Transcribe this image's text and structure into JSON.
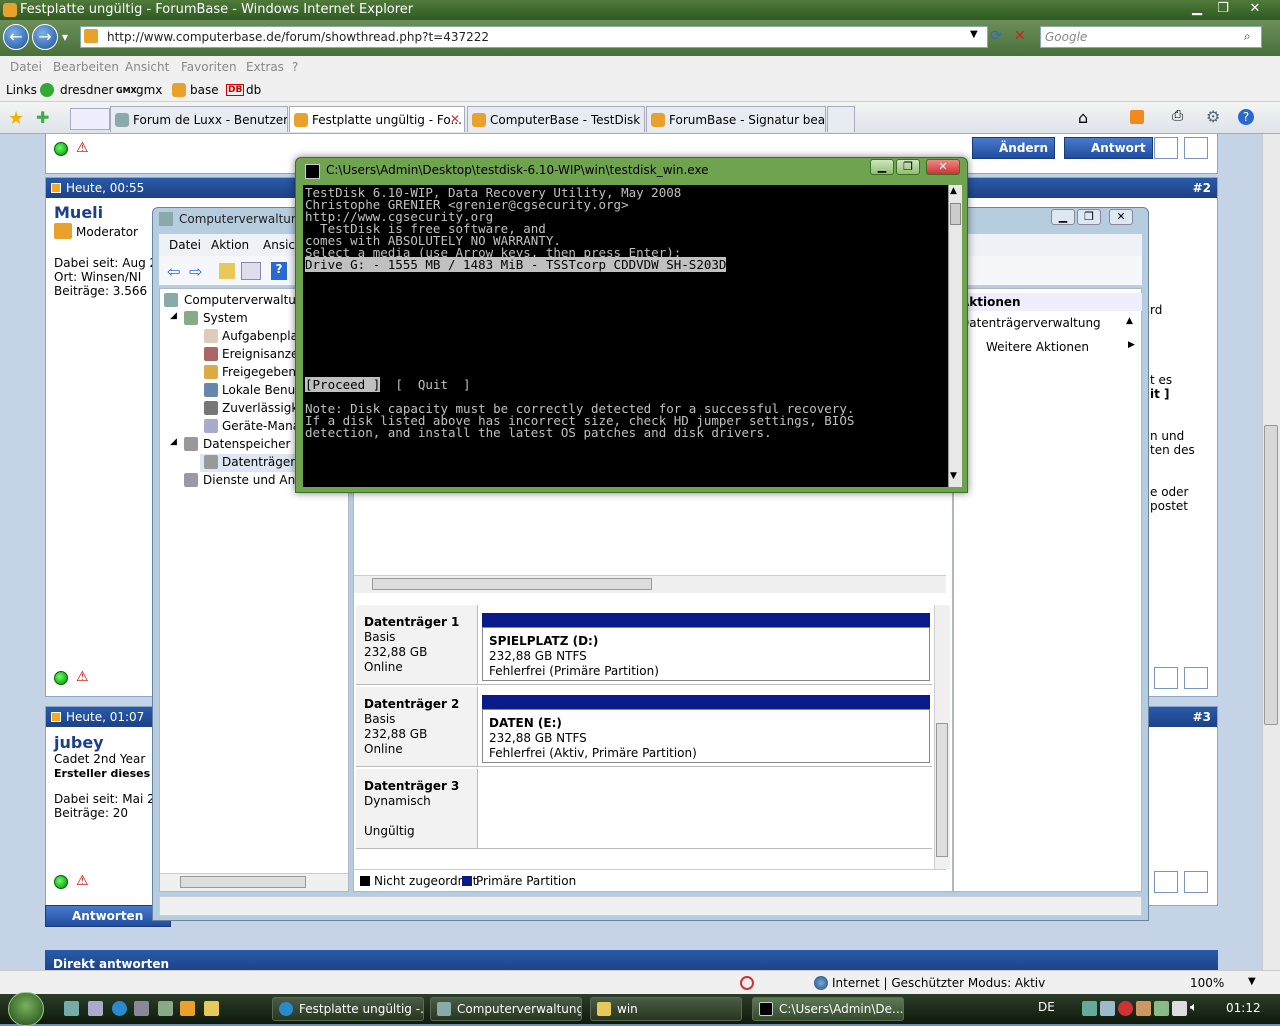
{
  "ie": {
    "title": "Festplatte ungültig - ForumBase - Windows Internet Explorer",
    "url": "http://www.computerbase.de/forum/showthread.php?t=437222",
    "search_placeholder": "Google",
    "menu": [
      "Datei",
      "Bearbeiten",
      "Ansicht",
      "Favoriten",
      "Extras",
      "?"
    ],
    "links": {
      "label": "Links",
      "items": [
        "dresdner",
        "gmx",
        "base",
        "db"
      ]
    },
    "tabs": [
      {
        "label": "Forum de Luxx - Benutzerk...",
        "active": false
      },
      {
        "label": "Festplatte ungültig - Fo...",
        "active": true
      },
      {
        "label": "ComputerBase - TestDisk ...",
        "active": false
      },
      {
        "label": "ForumBase - Signatur bear...",
        "active": false
      }
    ],
    "status": {
      "zone": "Internet | Geschützter Modus: Aktiv",
      "zoom": "100%"
    }
  },
  "forum": {
    "buttons": {
      "andern": "Ändern",
      "antwort": "Antwort",
      "antworten": "Antworten"
    },
    "post2": {
      "time": "Heute, 00:55",
      "num": "#2",
      "user": "Mueli",
      "rank": "Moderator",
      "since": "Dabei seit: Aug 2",
      "place": "Ort: Winsen/NI",
      "posts": "Beiträge: 3.566",
      "snippets": [
        "rd",
        "t es",
        "it ]",
        "n und",
        "ten des",
        "e oder",
        "postet"
      ]
    },
    "post3": {
      "time": "Heute, 01:07",
      "num": "#3",
      "user": "jubey",
      "rank": "Cadet 2nd Year",
      "starter": "Ersteller dieses T",
      "since": "Dabei seit: Mai 2",
      "posts": "Beiträge: 20"
    },
    "direct_reply": "Direkt antworten"
  },
  "cv": {
    "title": "Computerverwaltung",
    "menu": [
      "Datei",
      "Aktion",
      "Ansicht"
    ],
    "tree": [
      "Computerverwaltung",
      "System",
      "Aufgabenplan",
      "Ereignisanzeig",
      "Freigegebene",
      "Lokale Benutz",
      "Zuverlässigke",
      "Geräte-Manag",
      "Datenspeicher",
      "Datenträgerve",
      "Dienste und Anw"
    ],
    "actions": {
      "header": "Aktionen",
      "section": "Datenträgerverwaltung",
      "more": "Weitere Aktionen"
    },
    "disks": [
      {
        "name": "Datenträger 1",
        "type": "Basis",
        "size": "232,88 GB",
        "state": "Online",
        "vol": "SPIELPLATZ  (D:)",
        "fs": "232,88 GB NTFS",
        "health": "Fehlerfrei (Primäre Partition)"
      },
      {
        "name": "Datenträger 2",
        "type": "Basis",
        "size": "232,88 GB",
        "state": "Online",
        "vol": "DATEN  (E:)",
        "fs": "232,88 GB NTFS",
        "health": "Fehlerfrei (Aktiv, Primäre Partition)"
      },
      {
        "name": "Datenträger 3",
        "type": "Dynamisch",
        "size": "",
        "state": "Ungültig"
      }
    ],
    "legend": [
      "Nicht zugeordnet",
      "Primäre Partition"
    ]
  },
  "cmd": {
    "title": "C:\\Users\\Admin\\Desktop\\testdisk-6.10-WIP\\win\\testdisk_win.exe",
    "lines": [
      "TestDisk 6.10-WIP, Data Recovery Utility, May 2008",
      "Christophe GRENIER <grenier@cgsecurity.org>",
      "http://www.cgsecurity.org",
      "",
      "  TestDisk is free software, and",
      "comes with ABSOLUTELY NO WARRANTY.",
      "",
      "Select a media (use Arrow keys, then press Enter):"
    ],
    "drive": "Drive G: - 1555 MB / 1483 MiB - TSSTcorp CDDVDW SH-S203D",
    "proceed": "[Proceed ]",
    "quit": "[  Quit  ]",
    "note": [
      "Note: Disk capacity must be correctly detected for a successful recovery.",
      "If a disk listed above has incorrect size, check HD jumper settings, BIOS",
      "detection, and install the latest OS patches and disk drivers."
    ]
  },
  "taskbar": {
    "items": [
      "Festplatte ungültig -...",
      "Computerverwaltung",
      "win",
      "C:\\Users\\Admin\\De..."
    ],
    "lang": "DE",
    "clock": "01:12"
  }
}
